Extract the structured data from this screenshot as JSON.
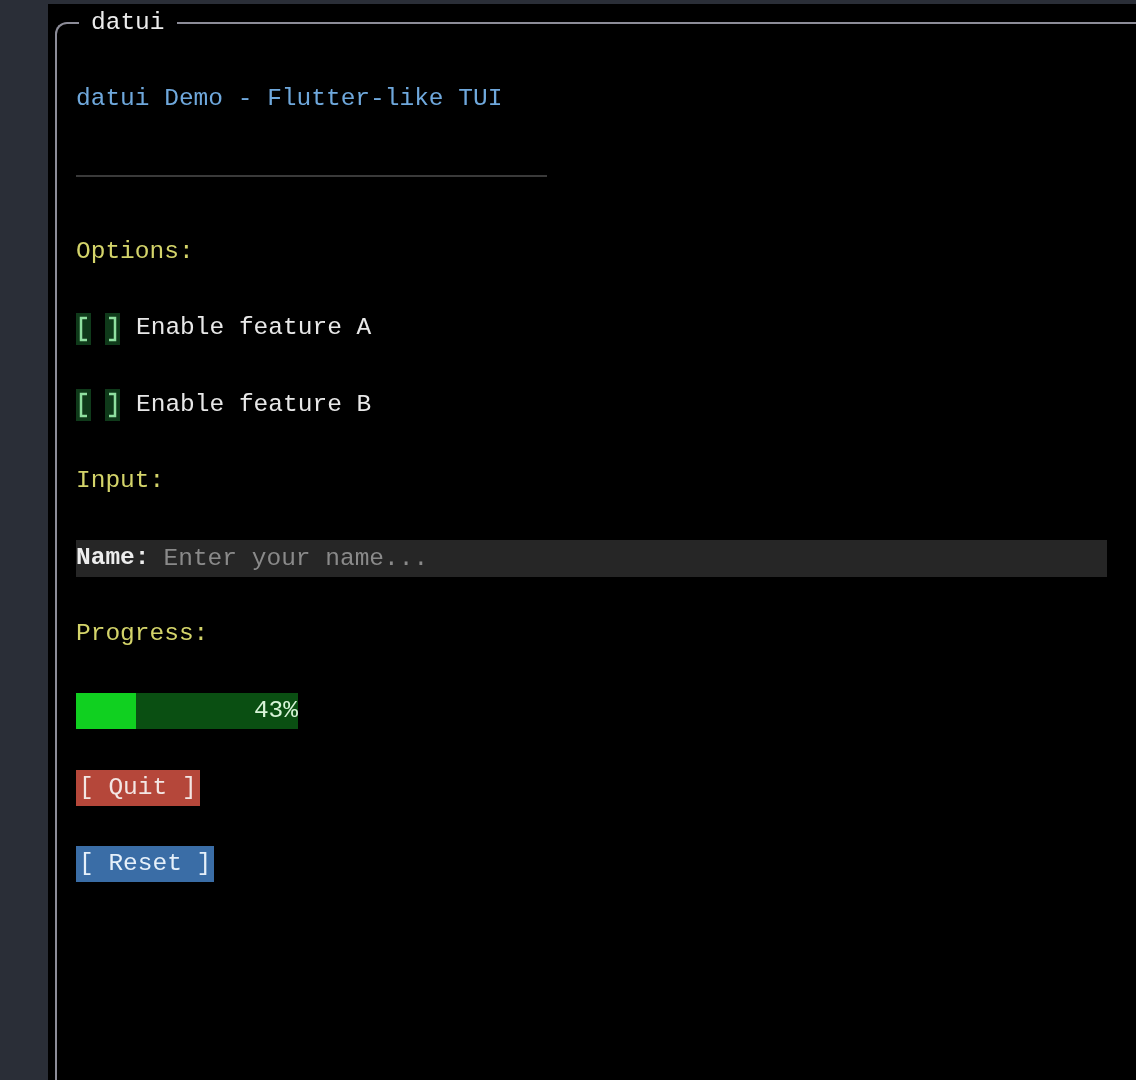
{
  "frame": {
    "title": "datui"
  },
  "app_title": "datui Demo - Flutter-like TUI",
  "options": {
    "label": "Options:",
    "checkboxes": [
      {
        "label": "Enable feature A",
        "checked": false
      },
      {
        "label": "Enable feature B",
        "checked": false
      }
    ]
  },
  "input": {
    "label": "Input:",
    "field_label": "Name:",
    "placeholder": "Enter your name..."
  },
  "progress": {
    "label": "Progress:",
    "level": 0.27,
    "reading": "43%"
  },
  "buttons": [
    {
      "label": "[ Quit ]",
      "kind": "danger"
    },
    {
      "label": "[ Reset ]",
      "kind": "primary"
    }
  ]
}
